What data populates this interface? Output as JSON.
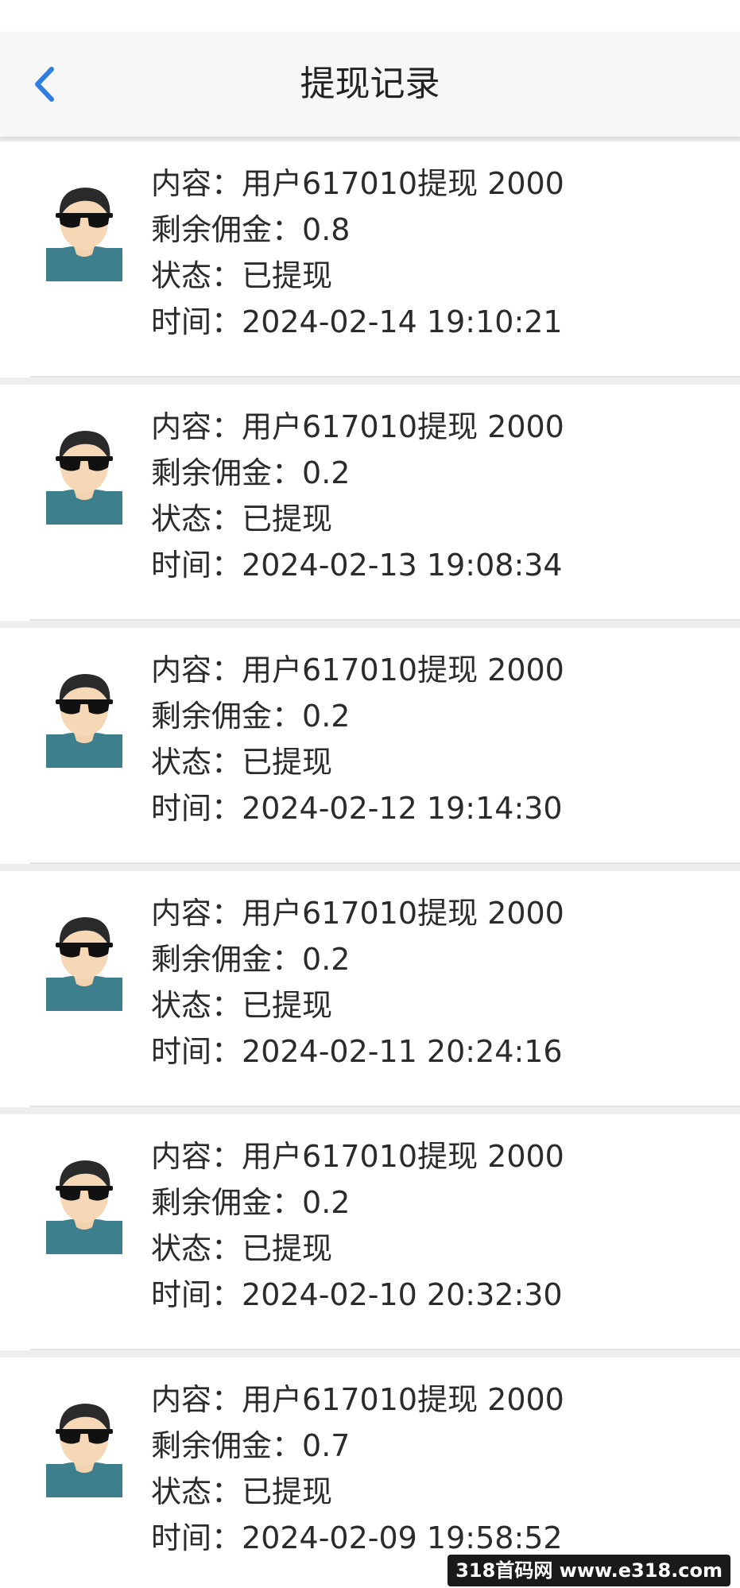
{
  "header": {
    "title": "提现记录",
    "back_icon": "chevron-left-icon",
    "back_color": "#2f7de1"
  },
  "labels": {
    "content": "内容：",
    "remaining": "剩余佣金：",
    "status": "状态：",
    "time": "时间："
  },
  "records": [
    {
      "content": "用户617010提现 2000",
      "remaining": "0.8",
      "status": "已提现",
      "time": "2024-02-14 19:10:21"
    },
    {
      "content": "用户617010提现 2000",
      "remaining": "0.2",
      "status": "已提现",
      "time": "2024-02-13 19:08:34"
    },
    {
      "content": "用户617010提现 2000",
      "remaining": "0.2",
      "status": "已提现",
      "time": "2024-02-12 19:14:30"
    },
    {
      "content": "用户617010提现 2000",
      "remaining": "0.2",
      "status": "已提现",
      "time": "2024-02-11 20:24:16"
    },
    {
      "content": "用户617010提现 2000",
      "remaining": "0.2",
      "status": "已提现",
      "time": "2024-02-10 20:32:30"
    },
    {
      "content": "用户617010提现 2000",
      "remaining": "0.7",
      "status": "已提现",
      "time": "2024-02-09 19:58:52"
    }
  ],
  "avatar_icon": "user-with-sunglasses-icon",
  "watermark": "318首码网 www.e318.com"
}
